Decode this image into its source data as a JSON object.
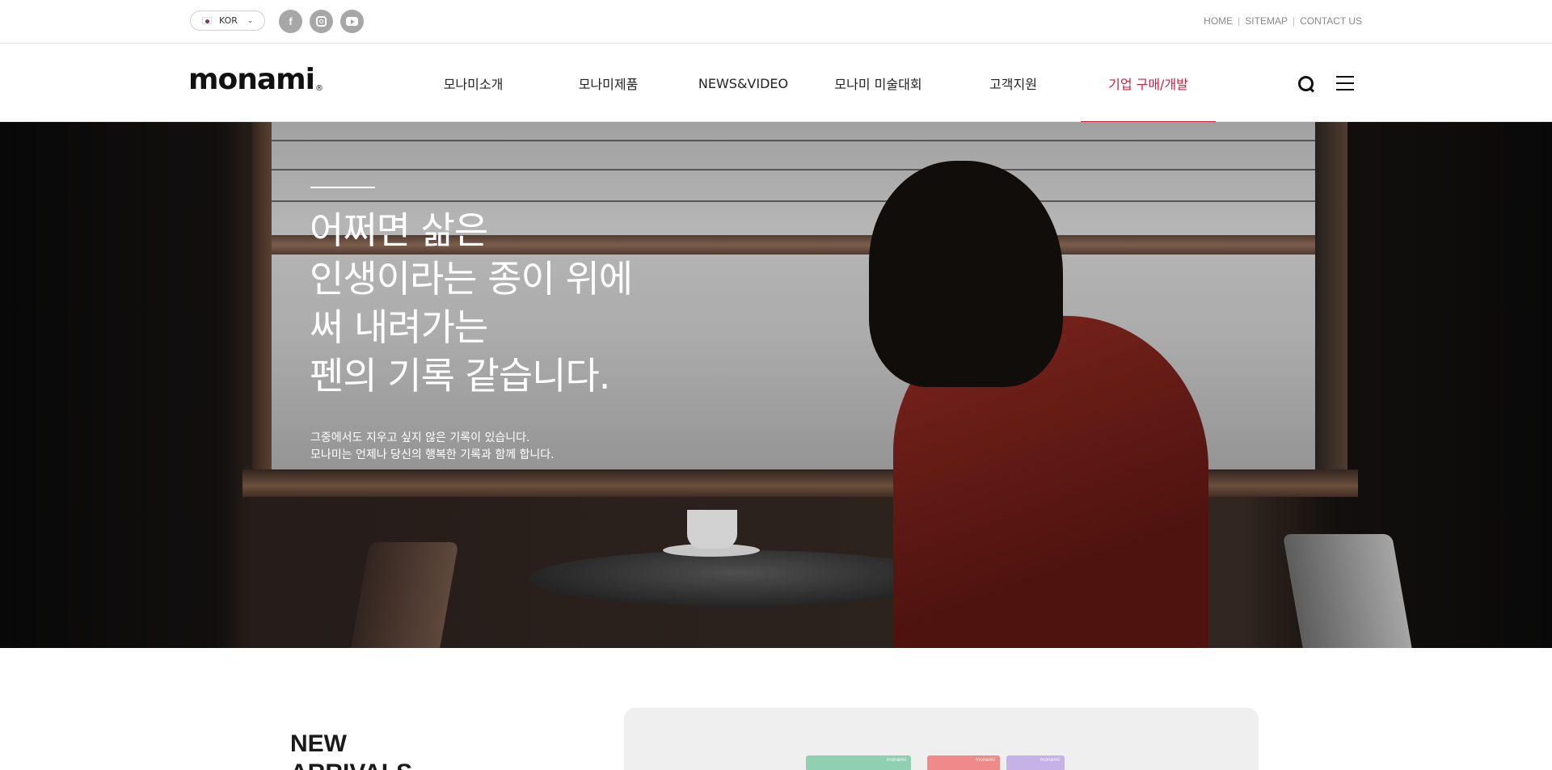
{
  "topbar": {
    "language": "KOR",
    "social": [
      "facebook-icon",
      "instagram-icon",
      "youtube-icon"
    ],
    "links": [
      "HOME",
      "SITEMAP",
      "CONTACT US"
    ]
  },
  "header": {
    "logo": "monami",
    "logo_mark": "®",
    "nav": [
      "모나미소개",
      "모나미제품",
      "NEWS&VIDEO",
      "모나미 미술대회",
      "고객지원",
      "기업 구매/개발"
    ],
    "active_nav_index": 5,
    "accent_color": "#d51e3c"
  },
  "hero": {
    "title_lines": [
      "어쩌면 삶은",
      "인생이라는 종이 위에",
      "써 내려가는",
      "펜의 기록 같습니다."
    ],
    "subtitle_lines": [
      "그중에서도 지우고 싶지 않은 기록이 있습니다.",
      "모나미는 언제나 당신의 행복한 기록과 함께 합니다."
    ]
  },
  "arrivals": {
    "title_lines": [
      "NEW",
      "ARRIVALS"
    ],
    "product_tags": [
      "monami",
      "monami",
      "monami"
    ]
  }
}
